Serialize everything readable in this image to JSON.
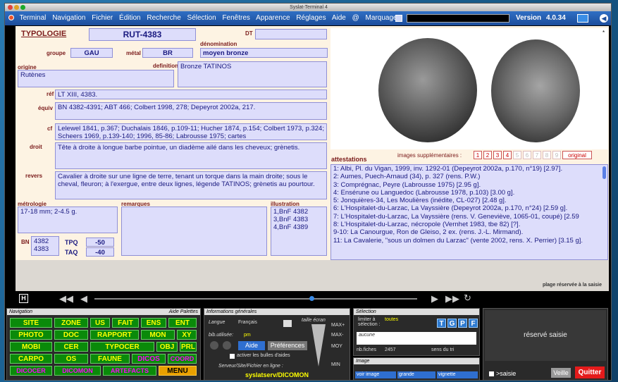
{
  "window": {
    "title": "Syslat-Terminal 4"
  },
  "menu": {
    "items": [
      "Terminal",
      "Navigation",
      "Fichier",
      "Édition",
      "Recherche",
      "Sélection",
      "Fenêtres",
      "Apparence",
      "Réglages",
      "Aide",
      "@",
      "Marquage"
    ],
    "version_label": "Version",
    "version": "4.0.34"
  },
  "record": {
    "typologie_label": "TYPOLOGIE",
    "typologie": "RUT-4383",
    "dt_label": "DT",
    "dt": "",
    "denomination_label": "dénomination",
    "denomination": "moyen bronze",
    "groupe_label": "groupe",
    "groupe": "GAU",
    "metal_label": "métal",
    "metal": "BR",
    "origine_label": "origine",
    "origine": "Rutènes",
    "definition_label": "definition",
    "definition": "Bronze TATINOS",
    "ref_label": "réf",
    "ref": "LT XIII, 4383.",
    "equiv_label": "équiv",
    "equiv": "BN 4382-4391; ABT 466; Colbert 1998, 278; Depeyrot 2002a, 217.",
    "cf_label": "cf",
    "cf": "Lelewel 1841, p.367; Duchalais 1846, p.109-11; Hucher 1874, p.154; Colbert 1973, p.324; Scheers 1969, p.139-140; 1996, 85-86; Labrousse 1975; cartes",
    "droit_label": "droit",
    "droit": "Tête à droite à longue barbe pointue, un diadème ailé dans les cheveux; grènetis.",
    "revers_label": "revers",
    "revers": "Cavalier à droite sur une ligne de terre, tenant un torque dans la main droite; sous le cheval, fleuron; à l'exergue, entre deux lignes, légende TATINOS; grènetis au pourtour.",
    "metrologie_label": "métrologie",
    "metrologie": "17-18 mm; 2-4.5 g.",
    "remarques_label": "remarques",
    "remarques": "",
    "illustration_label": "illustration",
    "illustration": [
      "1,BnF 4382",
      "3,BnF 4383",
      "4,BnF 4389"
    ],
    "bn_label": "BN",
    "bn": [
      "4382",
      "4383"
    ],
    "tpq_label": "TPQ",
    "tpq": "-50",
    "taq_label": "TAQ",
    "taq": "-40",
    "attestations_label": "attestations",
    "images_sup_label": "images supplémentaires :",
    "images_sup": [
      "1",
      "2",
      "3",
      "4",
      "5",
      "6",
      "7",
      "8",
      "9"
    ],
    "original_label": "original",
    "attestations": [
      "1: Albi, Pl. du Vigan, 1999, inv. 1292-01 (Depeyrot 2002a, p.170, n°19) [2.97].",
      "2: Aumes, Puech-Arnaud (34), p. 327 (rens. P.W.)",
      "3: Comprégnac, Peyre (Labrousse 1975) [2.95 g].",
      "4: Ensérune ou Languedoc (Labrousse 1978, p.103) [3.00 g].",
      "5: Jonquières-34, Les Moulières (inédite, CL-027) [2.48 g].",
      "6: L'Hospitalet-du-Larzac, La Vayssière (Depeyrot 2002a, p.170, n°24) [2.59 g].",
      "7: L'Hospitalet-du-Larzac, La Vayssière (rens. V. Geneviève, 1065-01, coupé) [2.59",
      "8: L'Hospitalet-du-Larzac, nécropole (Vernhet 1983, tbe 82) [?].",
      "9-10: La Canourgue, Ron de Gleiso, 2 ex. (rens. J.-L. Mirmand).",
      "11: La Cavalerie, \"sous un dolmen du Larzac\" (vente 2002, rens. X. Perrier) [3.15 g]."
    ],
    "plage_label": "plage réservée à la saisie"
  },
  "navigation": {
    "title": "Navigation",
    "palettes_label": "Aide Palettes",
    "rows": [
      [
        "SITE",
        "ZONE",
        "US",
        "FAIT",
        "ENS",
        "ENT"
      ],
      [
        "PHOTO",
        "DOC",
        "RAPPORT",
        "MON",
        "XY"
      ],
      [
        "MOBI",
        "CER",
        "TYPOCER",
        "OBJ",
        "PRL"
      ],
      [
        "CARPO",
        "OS",
        "FAUNE",
        "DICOS",
        "COORD"
      ],
      [
        "DICOCER",
        "DICOMON",
        "ARTEFACTS",
        "MENU"
      ]
    ]
  },
  "infos": {
    "title": "Informations générales",
    "langue_label": "Langue",
    "langue": "Français",
    "taille_label": "taille écran",
    "max_plus": "MAX+",
    "max_minus": "MAX-",
    "moy": "MOY",
    "min": "MIN",
    "bib_label": "bib.utilisée:",
    "bib": "pm",
    "aide_label": "Aide",
    "preferences_label": "Préférences",
    "bulles_label": "activer les bulles d'aides",
    "serveur_label": "Serveur/Site/Fichier en ligne :",
    "serveur": "syslatserv/DICOMON"
  },
  "selection": {
    "title": "Sélection",
    "limiter_label": "limiter à sélection :",
    "limiter": "toutes",
    "tgpf": [
      "T",
      "G",
      "P",
      "F"
    ],
    "aucune": "aucune",
    "nbfiches_label": "nb.fiches",
    "nbfiches": "2457",
    "sens_label": "sens du tri"
  },
  "image": {
    "title": "Image",
    "voir_label": "voir image",
    "grande_label": "grande",
    "vignette_label": "vignette"
  },
  "saisie": {
    "reserve_label": "réservé saisie",
    "saisie_label": ">saisie",
    "veille_label": "Veille",
    "quitter_label": "Quitter"
  }
}
